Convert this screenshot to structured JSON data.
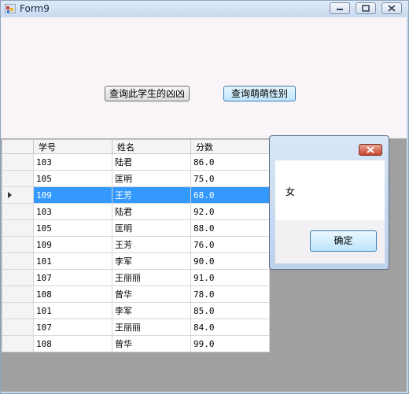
{
  "window": {
    "title": "Form9"
  },
  "buttons": {
    "query_gender_label": "查询此学生的凶凶",
    "query_cute_gender_label": "查询萌萌性别"
  },
  "grid": {
    "columns": [
      "学号",
      "姓名",
      "分数"
    ],
    "rows": [
      {
        "id": "103",
        "name": "陆君",
        "score": "86.0"
      },
      {
        "id": "105",
        "name": "匡明",
        "score": "75.0"
      },
      {
        "id": "109",
        "name": "王芳",
        "score": "68.0"
      },
      {
        "id": "103",
        "name": "陆君",
        "score": "92.0"
      },
      {
        "id": "105",
        "name": "匡明",
        "score": "88.0"
      },
      {
        "id": "109",
        "name": "王芳",
        "score": "76.0"
      },
      {
        "id": "101",
        "name": "李军",
        "score": "90.0"
      },
      {
        "id": "107",
        "name": "王丽丽",
        "score": "91.0"
      },
      {
        "id": "108",
        "name": "曾华",
        "score": "78.0"
      },
      {
        "id": "101",
        "name": "李军",
        "score": "85.0"
      },
      {
        "id": "107",
        "name": "王丽丽",
        "score": "84.0"
      },
      {
        "id": "108",
        "name": "曾华",
        "score": "99.0"
      }
    ],
    "selected_row_index": 2
  },
  "dialog": {
    "message": "女",
    "ok_label": "确定"
  },
  "colors": {
    "selection": "#3399ff",
    "grid_background": "#a0a0a0"
  }
}
